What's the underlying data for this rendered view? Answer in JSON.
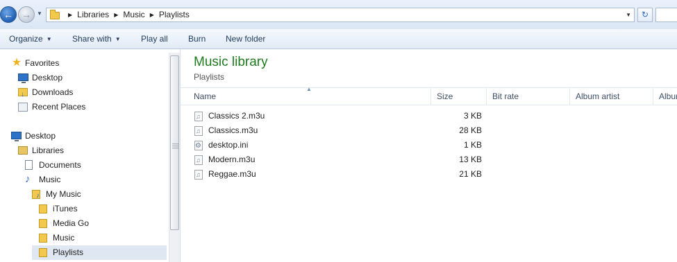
{
  "address": {
    "crumbs": [
      "Libraries",
      "Music",
      "Playlists"
    ]
  },
  "toolbar": {
    "organize": "Organize",
    "share_with": "Share with",
    "play_all": "Play all",
    "burn": "Burn",
    "new_folder": "New folder"
  },
  "nav": {
    "favorites": "Favorites",
    "desktop_fav": "Desktop",
    "downloads": "Downloads",
    "recent": "Recent Places",
    "desktop": "Desktop",
    "libraries": "Libraries",
    "documents": "Documents",
    "music": "Music",
    "my_music": "My Music",
    "itunes": "iTunes",
    "media_go": "Media Go",
    "music_sub": "Music",
    "playlists": "Playlists"
  },
  "content": {
    "title": "Music library",
    "subtitle": "Playlists",
    "columns": [
      "Name",
      "Size",
      "Bit rate",
      "Album artist",
      "Album"
    ],
    "files": [
      {
        "name": "Classics 2.m3u",
        "size": "3 KB",
        "icon": "playlist-file-icon"
      },
      {
        "name": "Classics.m3u",
        "size": "28 KB",
        "icon": "playlist-file-icon"
      },
      {
        "name": "desktop.ini",
        "size": "1 KB",
        "icon": "settings-file-icon"
      },
      {
        "name": "Modern.m3u",
        "size": "13 KB",
        "icon": "playlist-file-icon"
      },
      {
        "name": "Reggae.m3u",
        "size": "21 KB",
        "icon": "playlist-file-icon"
      }
    ]
  },
  "colors": {
    "title_green": "#1e7b1e",
    "command_text": "#1e395b",
    "selection": "#dfe7f2"
  }
}
